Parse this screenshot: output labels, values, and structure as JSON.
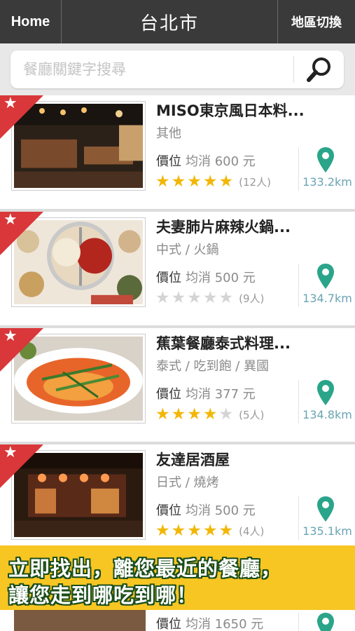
{
  "header": {
    "home_label": "Home",
    "title": "台北市",
    "switch_label": "地區切換"
  },
  "search": {
    "placeholder": "餐廳關鍵字搜尋",
    "value": ""
  },
  "price_label": "價位",
  "restaurants": [
    {
      "name": "MISO東京風日本料...",
      "category": "其他",
      "price": "均消 600 元",
      "rating": 5,
      "count": "(12人)",
      "distance": "133.2km"
    },
    {
      "name": "夫妻肺片麻辣火鍋...",
      "category": "中式 / 火鍋",
      "price": "均消 500 元",
      "rating": 0,
      "count": "(9人)",
      "distance": "134.7km"
    },
    {
      "name": "蕉葉餐廳泰式料理...",
      "category": "泰式 / 吃到飽 / 異國",
      "price": "均消 377 元",
      "rating": 4,
      "count": "(5人)",
      "distance": "134.8km"
    },
    {
      "name": "友達居酒屋",
      "category": "日式 / 燒烤",
      "price": "均消 500 元",
      "rating": 5,
      "count": "(4人)",
      "distance": "135.1km"
    }
  ],
  "partial_row": {
    "price": "均消 1650 元"
  },
  "banner": {
    "line1": "立即找出，離您最近的餐廳，",
    "line2": "讓您走到哪吃到哪！"
  },
  "colors": {
    "header_bg": "#3a3a3a",
    "ribbon": "#d9373a",
    "star_on": "#f2b705",
    "star_off": "#d4d4d4",
    "pin": "#2aa58a",
    "distance": "#6aa4b4",
    "banner_bg": "#f7c623"
  },
  "icons": {
    "search": "magnifier-icon",
    "ribbon_star": "star-icon",
    "location": "map-pin-icon"
  }
}
